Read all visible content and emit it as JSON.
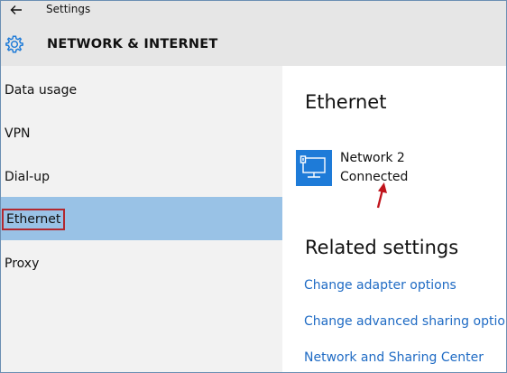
{
  "window": {
    "title": "Settings"
  },
  "header": {
    "title": "NETWORK & INTERNET"
  },
  "sidebar": {
    "items": [
      {
        "label": "Data usage"
      },
      {
        "label": "VPN"
      },
      {
        "label": "Dial-up"
      },
      {
        "label": "Ethernet",
        "selected": true
      },
      {
        "label": "Proxy"
      }
    ]
  },
  "main": {
    "title": "Ethernet",
    "network": {
      "name": "Network  2",
      "status": "Connected"
    },
    "related_title": "Related settings",
    "links": [
      "Change adapter options",
      "Change advanced sharing options",
      "Network and Sharing Center"
    ]
  },
  "colors": {
    "accent": "#1e7bd8",
    "selected_bg": "#99c2e6",
    "link": "#1f6bc4",
    "highlight_box": "#b2282f",
    "arrow": "#c0141c"
  },
  "icons": {
    "back": "back-arrow-icon",
    "settings": "gear-icon",
    "network": "ethernet-monitor-icon"
  }
}
